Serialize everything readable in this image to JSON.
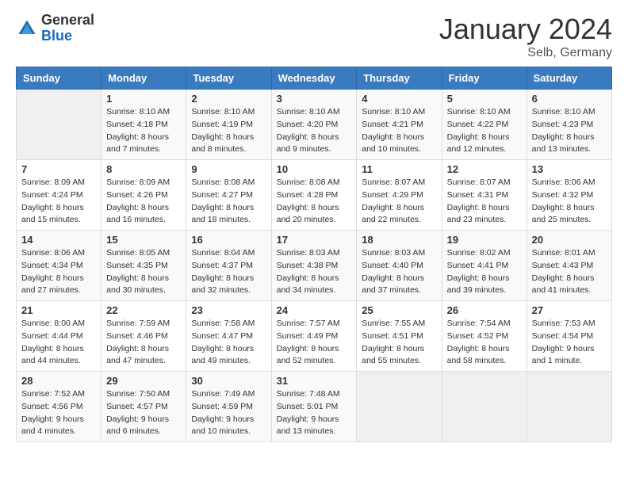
{
  "header": {
    "logo_general": "General",
    "logo_blue": "Blue",
    "month_title": "January 2024",
    "location": "Selb, Germany"
  },
  "days_of_week": [
    "Sunday",
    "Monday",
    "Tuesday",
    "Wednesday",
    "Thursday",
    "Friday",
    "Saturday"
  ],
  "weeks": [
    [
      {
        "day": "",
        "sunrise": "",
        "sunset": "",
        "daylight": "",
        "empty": true
      },
      {
        "day": "1",
        "sunrise": "Sunrise: 8:10 AM",
        "sunset": "Sunset: 4:18 PM",
        "daylight": "Daylight: 8 hours and 7 minutes."
      },
      {
        "day": "2",
        "sunrise": "Sunrise: 8:10 AM",
        "sunset": "Sunset: 4:19 PM",
        "daylight": "Daylight: 8 hours and 8 minutes."
      },
      {
        "day": "3",
        "sunrise": "Sunrise: 8:10 AM",
        "sunset": "Sunset: 4:20 PM",
        "daylight": "Daylight: 8 hours and 9 minutes."
      },
      {
        "day": "4",
        "sunrise": "Sunrise: 8:10 AM",
        "sunset": "Sunset: 4:21 PM",
        "daylight": "Daylight: 8 hours and 10 minutes."
      },
      {
        "day": "5",
        "sunrise": "Sunrise: 8:10 AM",
        "sunset": "Sunset: 4:22 PM",
        "daylight": "Daylight: 8 hours and 12 minutes."
      },
      {
        "day": "6",
        "sunrise": "Sunrise: 8:10 AM",
        "sunset": "Sunset: 4:23 PM",
        "daylight": "Daylight: 8 hours and 13 minutes."
      }
    ],
    [
      {
        "day": "7",
        "sunrise": "Sunrise: 8:09 AM",
        "sunset": "Sunset: 4:24 PM",
        "daylight": "Daylight: 8 hours and 15 minutes."
      },
      {
        "day": "8",
        "sunrise": "Sunrise: 8:09 AM",
        "sunset": "Sunset: 4:26 PM",
        "daylight": "Daylight: 8 hours and 16 minutes."
      },
      {
        "day": "9",
        "sunrise": "Sunrise: 8:08 AM",
        "sunset": "Sunset: 4:27 PM",
        "daylight": "Daylight: 8 hours and 18 minutes."
      },
      {
        "day": "10",
        "sunrise": "Sunrise: 8:08 AM",
        "sunset": "Sunset: 4:28 PM",
        "daylight": "Daylight: 8 hours and 20 minutes."
      },
      {
        "day": "11",
        "sunrise": "Sunrise: 8:07 AM",
        "sunset": "Sunset: 4:29 PM",
        "daylight": "Daylight: 8 hours and 22 minutes."
      },
      {
        "day": "12",
        "sunrise": "Sunrise: 8:07 AM",
        "sunset": "Sunset: 4:31 PM",
        "daylight": "Daylight: 8 hours and 23 minutes."
      },
      {
        "day": "13",
        "sunrise": "Sunrise: 8:06 AM",
        "sunset": "Sunset: 4:32 PM",
        "daylight": "Daylight: 8 hours and 25 minutes."
      }
    ],
    [
      {
        "day": "14",
        "sunrise": "Sunrise: 8:06 AM",
        "sunset": "Sunset: 4:34 PM",
        "daylight": "Daylight: 8 hours and 27 minutes."
      },
      {
        "day": "15",
        "sunrise": "Sunrise: 8:05 AM",
        "sunset": "Sunset: 4:35 PM",
        "daylight": "Daylight: 8 hours and 30 minutes."
      },
      {
        "day": "16",
        "sunrise": "Sunrise: 8:04 AM",
        "sunset": "Sunset: 4:37 PM",
        "daylight": "Daylight: 8 hours and 32 minutes."
      },
      {
        "day": "17",
        "sunrise": "Sunrise: 8:03 AM",
        "sunset": "Sunset: 4:38 PM",
        "daylight": "Daylight: 8 hours and 34 minutes."
      },
      {
        "day": "18",
        "sunrise": "Sunrise: 8:03 AM",
        "sunset": "Sunset: 4:40 PM",
        "daylight": "Daylight: 8 hours and 37 minutes."
      },
      {
        "day": "19",
        "sunrise": "Sunrise: 8:02 AM",
        "sunset": "Sunset: 4:41 PM",
        "daylight": "Daylight: 8 hours and 39 minutes."
      },
      {
        "day": "20",
        "sunrise": "Sunrise: 8:01 AM",
        "sunset": "Sunset: 4:43 PM",
        "daylight": "Daylight: 8 hours and 41 minutes."
      }
    ],
    [
      {
        "day": "21",
        "sunrise": "Sunrise: 8:00 AM",
        "sunset": "Sunset: 4:44 PM",
        "daylight": "Daylight: 8 hours and 44 minutes."
      },
      {
        "day": "22",
        "sunrise": "Sunrise: 7:59 AM",
        "sunset": "Sunset: 4:46 PM",
        "daylight": "Daylight: 8 hours and 47 minutes."
      },
      {
        "day": "23",
        "sunrise": "Sunrise: 7:58 AM",
        "sunset": "Sunset: 4:47 PM",
        "daylight": "Daylight: 8 hours and 49 minutes."
      },
      {
        "day": "24",
        "sunrise": "Sunrise: 7:57 AM",
        "sunset": "Sunset: 4:49 PM",
        "daylight": "Daylight: 8 hours and 52 minutes."
      },
      {
        "day": "25",
        "sunrise": "Sunrise: 7:55 AM",
        "sunset": "Sunset: 4:51 PM",
        "daylight": "Daylight: 8 hours and 55 minutes."
      },
      {
        "day": "26",
        "sunrise": "Sunrise: 7:54 AM",
        "sunset": "Sunset: 4:52 PM",
        "daylight": "Daylight: 8 hours and 58 minutes."
      },
      {
        "day": "27",
        "sunrise": "Sunrise: 7:53 AM",
        "sunset": "Sunset: 4:54 PM",
        "daylight": "Daylight: 9 hours and 1 minute."
      }
    ],
    [
      {
        "day": "28",
        "sunrise": "Sunrise: 7:52 AM",
        "sunset": "Sunset: 4:56 PM",
        "daylight": "Daylight: 9 hours and 4 minutes."
      },
      {
        "day": "29",
        "sunrise": "Sunrise: 7:50 AM",
        "sunset": "Sunset: 4:57 PM",
        "daylight": "Daylight: 9 hours and 6 minutes."
      },
      {
        "day": "30",
        "sunrise": "Sunrise: 7:49 AM",
        "sunset": "Sunset: 4:59 PM",
        "daylight": "Daylight: 9 hours and 10 minutes."
      },
      {
        "day": "31",
        "sunrise": "Sunrise: 7:48 AM",
        "sunset": "Sunset: 5:01 PM",
        "daylight": "Daylight: 9 hours and 13 minutes."
      },
      {
        "day": "",
        "sunrise": "",
        "sunset": "",
        "daylight": "",
        "empty": true
      },
      {
        "day": "",
        "sunrise": "",
        "sunset": "",
        "daylight": "",
        "empty": true
      },
      {
        "day": "",
        "sunrise": "",
        "sunset": "",
        "daylight": "",
        "empty": true
      }
    ]
  ]
}
